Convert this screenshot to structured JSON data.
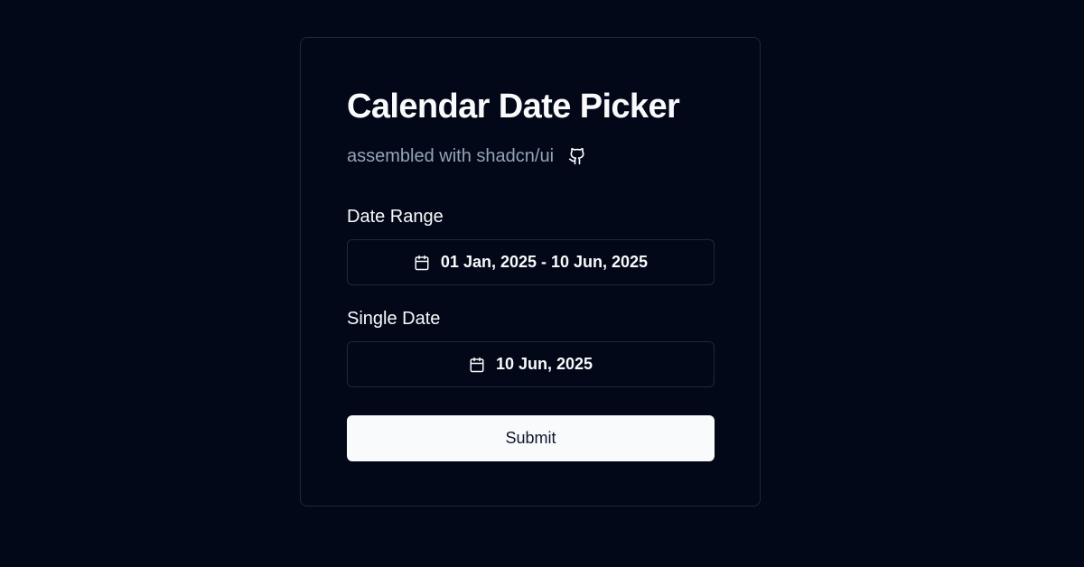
{
  "card": {
    "title": "Calendar Date Picker",
    "subtitle": "assembled with shadcn/ui",
    "subtitle_icon": "github-icon"
  },
  "date_range": {
    "label": "Date Range",
    "value": "01 Jan, 2025 - 10 Jun, 2025",
    "icon": "calendar-icon"
  },
  "single_date": {
    "label": "Single Date",
    "value": "10 Jun, 2025",
    "icon": "calendar-icon"
  },
  "submit": {
    "label": "Submit"
  },
  "colors": {
    "background": "#020817",
    "border": "#1e293b",
    "foreground": "#f8fafc",
    "muted": "#94a3b8",
    "primary_button": "#f8fafc",
    "primary_button_text": "#0f172a"
  }
}
